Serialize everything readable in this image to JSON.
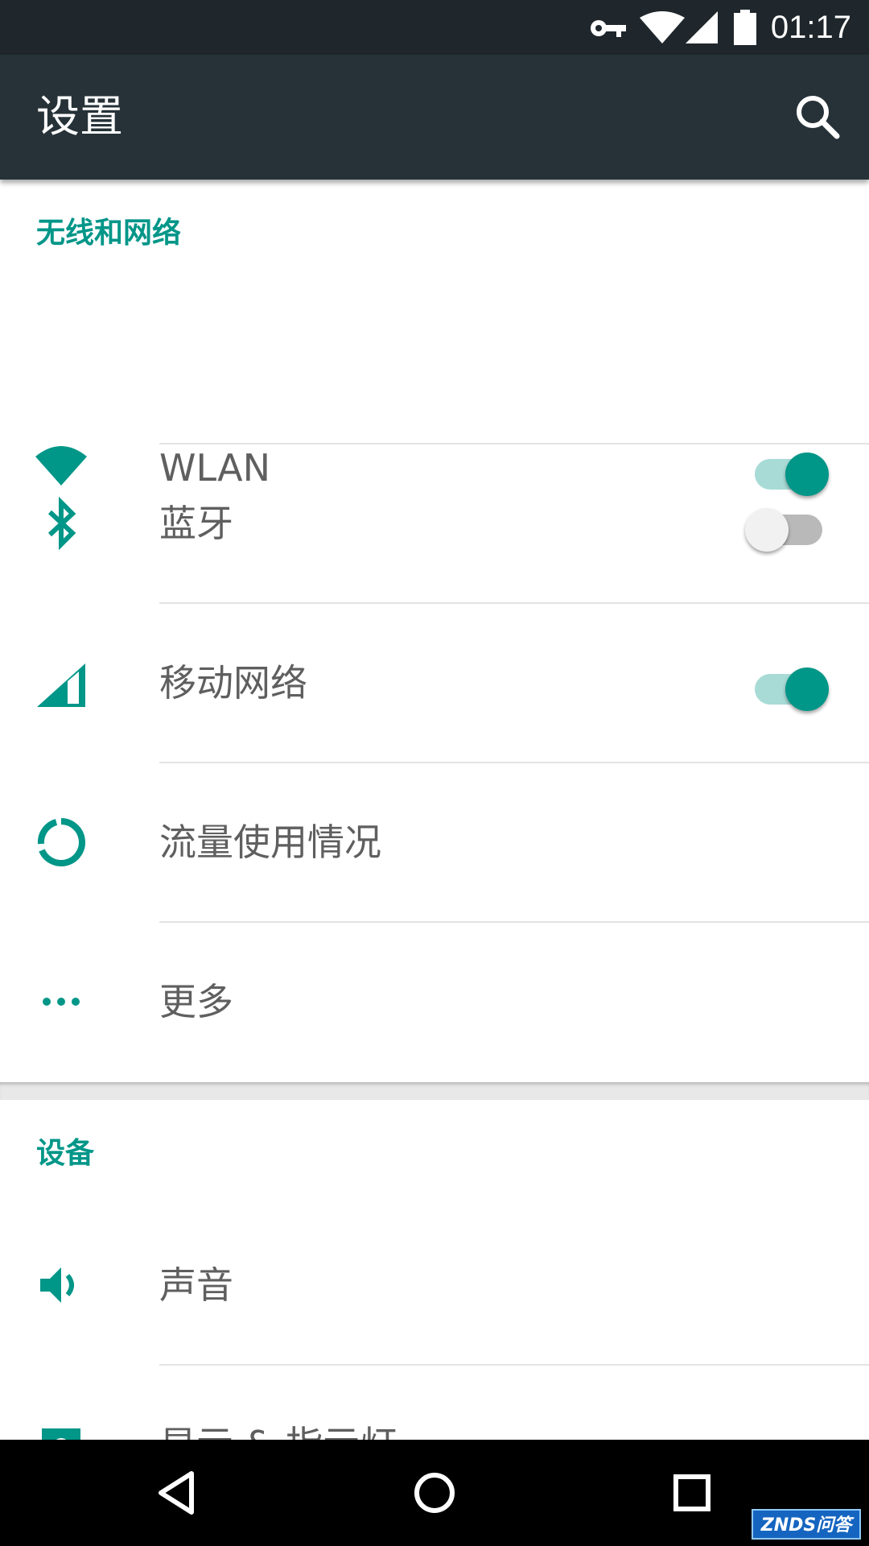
{
  "status_bar": {
    "time": "01:17",
    "icons": [
      "vpn-key-icon",
      "wifi-icon",
      "cell-signal-icon",
      "battery-icon"
    ]
  },
  "toolbar": {
    "title": "设置",
    "search_icon": "search-icon"
  },
  "sections": [
    {
      "title": "无线和网络",
      "items": [
        {
          "label": "WLAN",
          "icon": "wifi-icon",
          "switch": "on"
        },
        {
          "label": "蓝牙",
          "icon": "bluetooth-icon",
          "switch": "off"
        },
        {
          "label": "移动网络",
          "icon": "cell-signal-icon",
          "switch": "on"
        },
        {
          "label": "流量使用情况",
          "icon": "data-usage-icon"
        },
        {
          "label": "更多",
          "icon": "more-horiz-icon"
        }
      ]
    },
    {
      "title": "设备",
      "items": [
        {
          "label": "声音",
          "icon": "volume-icon"
        },
        {
          "label": "显示 & 指示灯",
          "icon": "display-settings-icon"
        }
      ]
    }
  ],
  "nav_bar": {
    "buttons": [
      "back-icon",
      "home-icon",
      "recents-icon"
    ]
  },
  "watermark": "ZNDS问答",
  "colors": {
    "accent": "#009688",
    "toolbar": "#263238",
    "status_bar": "#1f272c",
    "text": "#5f5f5f"
  }
}
